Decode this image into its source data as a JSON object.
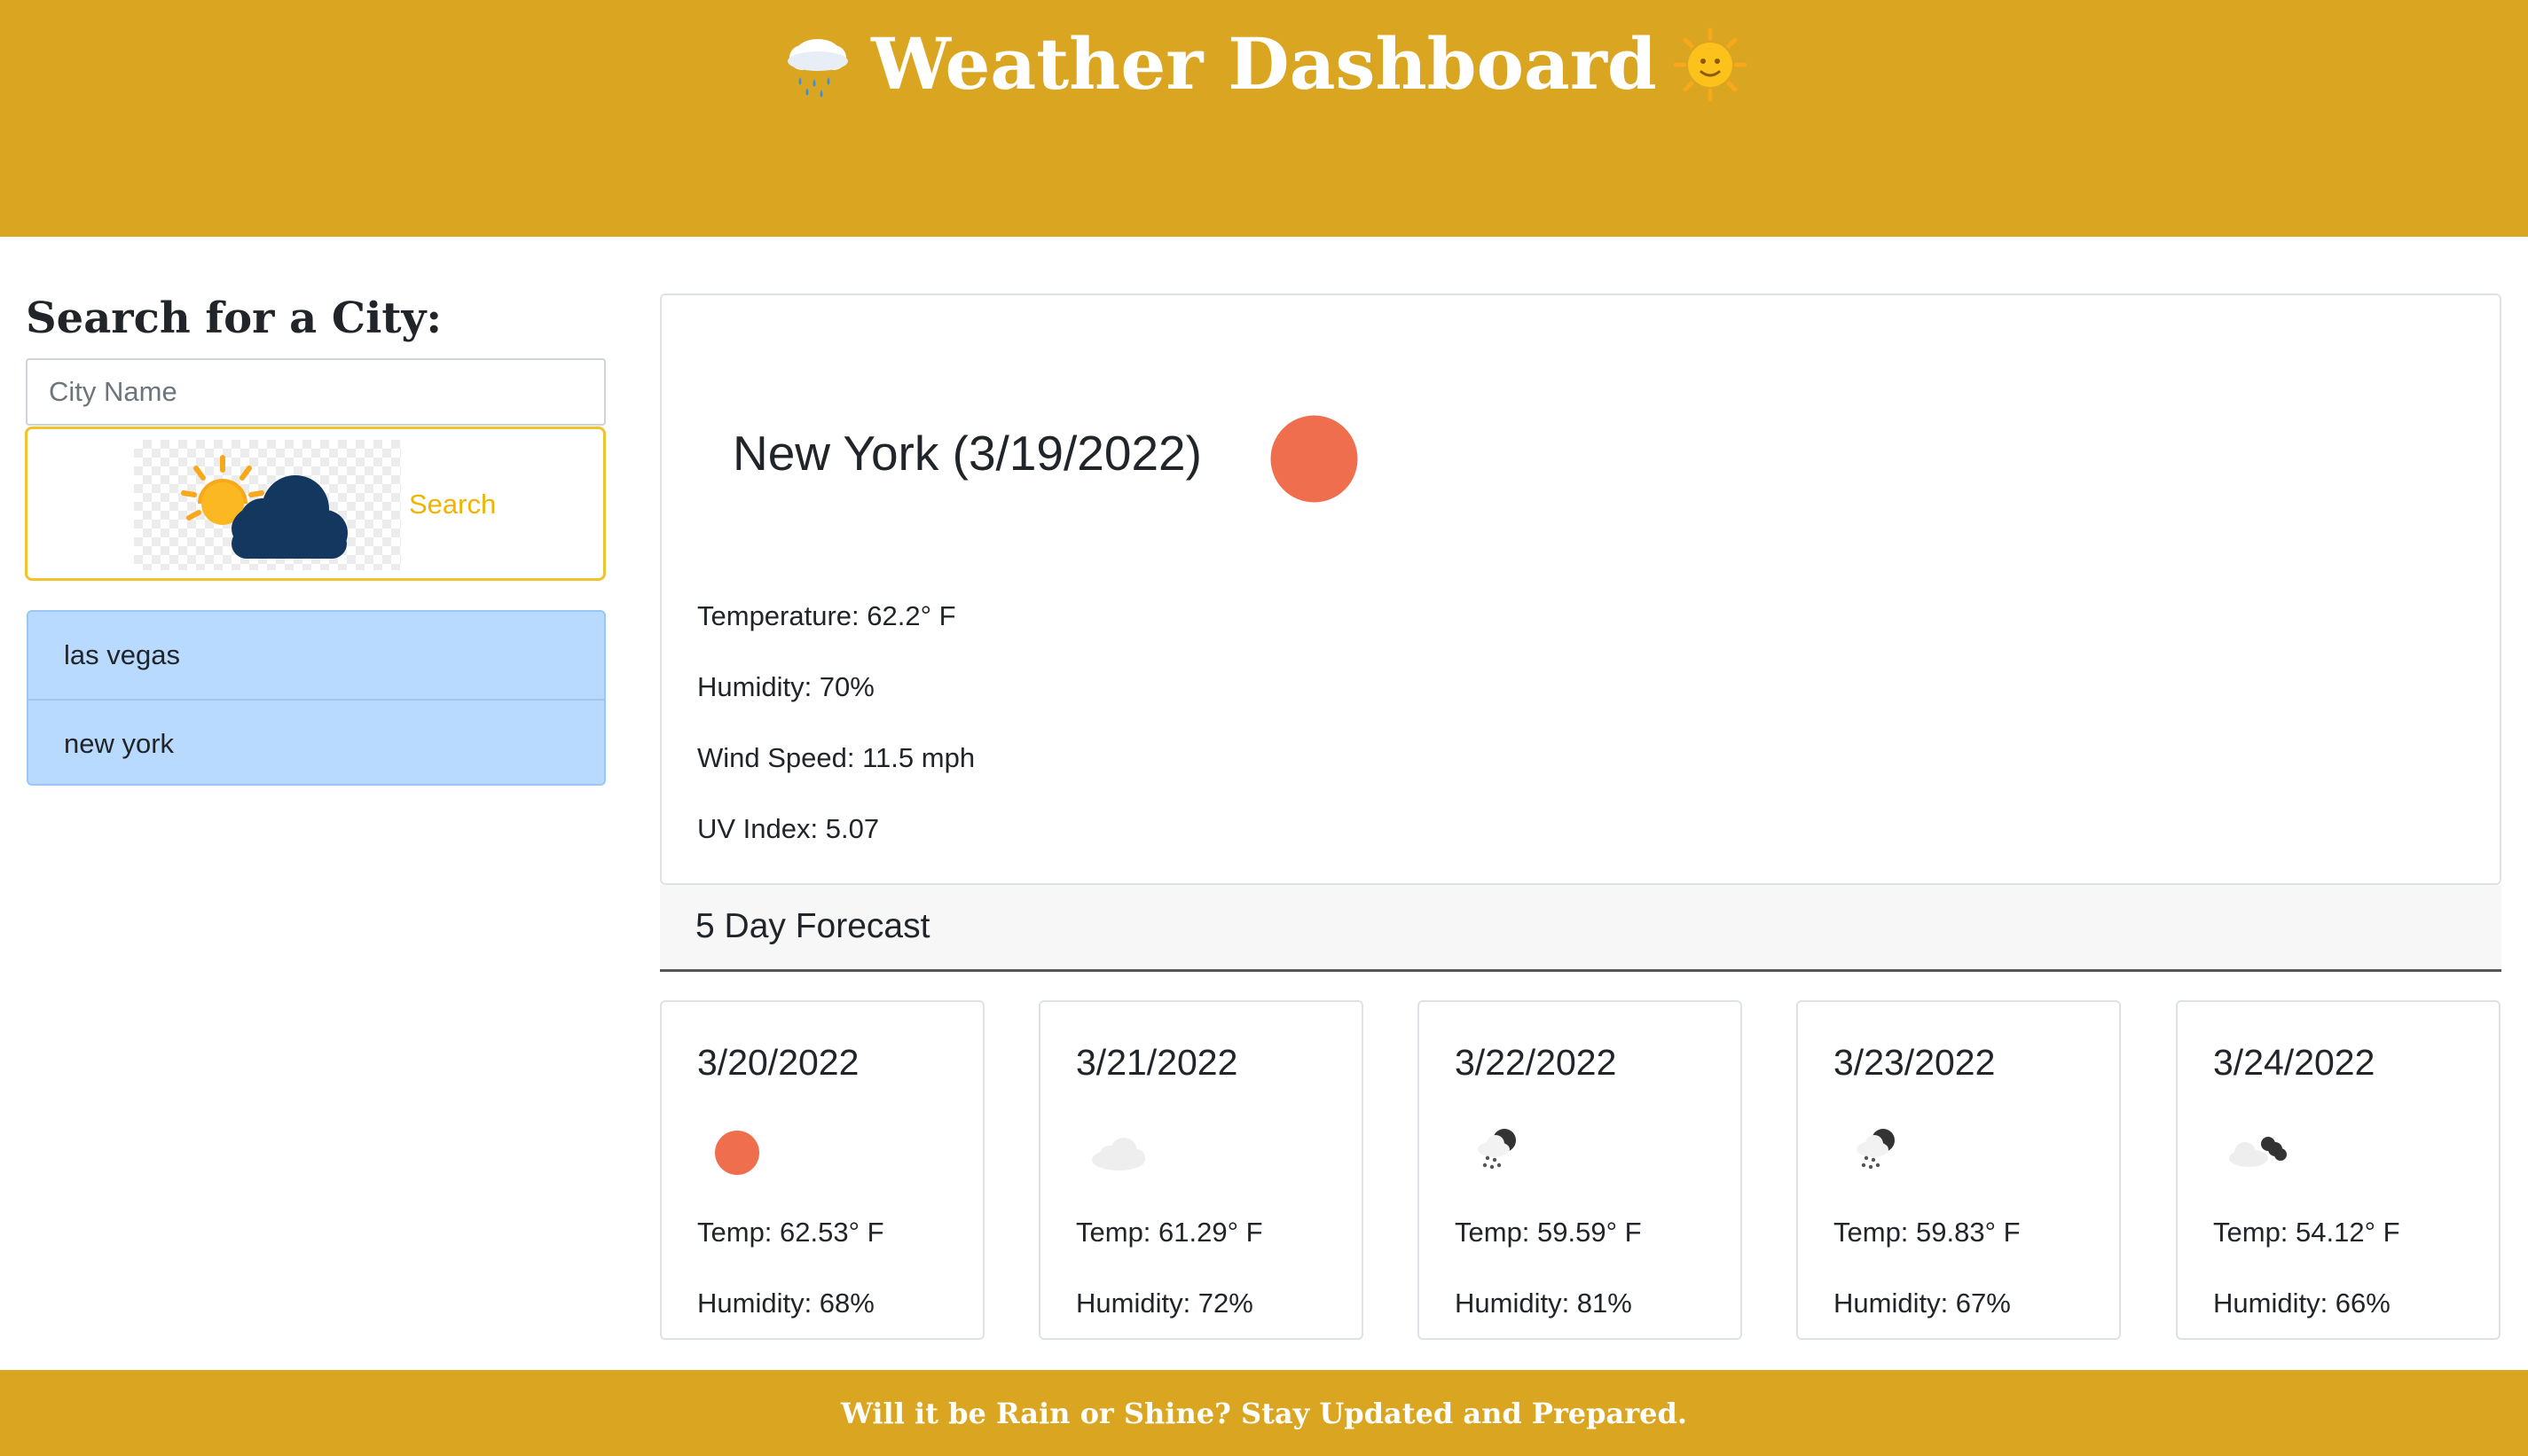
{
  "header": {
    "title": "Weather Dashboard",
    "left_icon": "rain-cloud-icon",
    "right_icon": "sun-face-icon"
  },
  "search": {
    "heading": "Search for a City:",
    "placeholder": "City Name",
    "value": "",
    "button_label": "Search",
    "button_image": "sun-behind-cloud-icon"
  },
  "history": [
    "las vegas",
    "new york"
  ],
  "current": {
    "title": "New York (3/19/2022)",
    "icon": "clear-sun-icon",
    "temperature": "Temperature: 62.2° F",
    "humidity": "Humidity: 70%",
    "wind": "Wind Speed: 11.5 mph",
    "uv": "UV Index: 5.07"
  },
  "forecast": {
    "title": "5 Day Forecast",
    "days": [
      {
        "date": "3/20/2022",
        "icon": "clear-sun-icon",
        "temp": "Temp: 62.53° F",
        "humidity": "Humidity: 68%"
      },
      {
        "date": "3/21/2022",
        "icon": "cloud-icon",
        "temp": "Temp: 61.29° F",
        "humidity": "Humidity: 72%"
      },
      {
        "date": "3/22/2022",
        "icon": "snow-cloud-icon",
        "temp": "Temp: 59.59° F",
        "humidity": "Humidity: 81%"
      },
      {
        "date": "3/23/2022",
        "icon": "snow-cloud-icon",
        "temp": "Temp: 59.83° F",
        "humidity": "Humidity: 67%"
      },
      {
        "date": "3/24/2022",
        "icon": "broken-clouds-icon",
        "temp": "Temp: 54.12° F",
        "humidity": "Humidity: 66%"
      }
    ]
  },
  "footer": {
    "text": "Will it be Rain or Shine? Stay Updated and Prepared."
  },
  "colors": {
    "brand": "#DAA520",
    "history_bg": "#B8DAFF",
    "search_accent": "#F0B400",
    "sun_icon": "#EE6E4E"
  }
}
